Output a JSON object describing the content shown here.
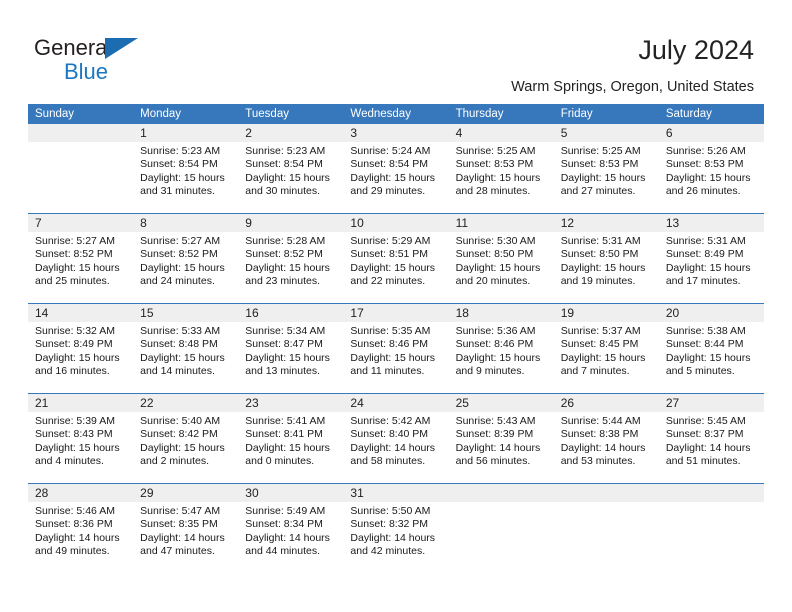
{
  "logo": {
    "line1": "General",
    "line2": "Blue",
    "triangle_color": "#1b6cb0",
    "line2_color": "#1b77c1"
  },
  "header": {
    "title": "July 2024",
    "location": "Warm Springs, Oregon, United States"
  },
  "theme": {
    "header_bar": "#3778bd",
    "daynum_band": "#efefef",
    "text": "#1a1a1a"
  },
  "calendar": {
    "weekday_headers": [
      "Sunday",
      "Monday",
      "Tuesday",
      "Wednesday",
      "Thursday",
      "Friday",
      "Saturday"
    ],
    "weeks": [
      [
        {
          "day": "",
          "sunrise": "",
          "sunset": "",
          "daylight_line1": "",
          "daylight_line2": "",
          "blank": true
        },
        {
          "day": "1",
          "sunrise": "Sunrise: 5:23 AM",
          "sunset": "Sunset: 8:54 PM",
          "daylight_line1": "Daylight: 15 hours",
          "daylight_line2": "and 31 minutes."
        },
        {
          "day": "2",
          "sunrise": "Sunrise: 5:23 AM",
          "sunset": "Sunset: 8:54 PM",
          "daylight_line1": "Daylight: 15 hours",
          "daylight_line2": "and 30 minutes."
        },
        {
          "day": "3",
          "sunrise": "Sunrise: 5:24 AM",
          "sunset": "Sunset: 8:54 PM",
          "daylight_line1": "Daylight: 15 hours",
          "daylight_line2": "and 29 minutes."
        },
        {
          "day": "4",
          "sunrise": "Sunrise: 5:25 AM",
          "sunset": "Sunset: 8:53 PM",
          "daylight_line1": "Daylight: 15 hours",
          "daylight_line2": "and 28 minutes."
        },
        {
          "day": "5",
          "sunrise": "Sunrise: 5:25 AM",
          "sunset": "Sunset: 8:53 PM",
          "daylight_line1": "Daylight: 15 hours",
          "daylight_line2": "and 27 minutes."
        },
        {
          "day": "6",
          "sunrise": "Sunrise: 5:26 AM",
          "sunset": "Sunset: 8:53 PM",
          "daylight_line1": "Daylight: 15 hours",
          "daylight_line2": "and 26 minutes."
        }
      ],
      [
        {
          "day": "7",
          "sunrise": "Sunrise: 5:27 AM",
          "sunset": "Sunset: 8:52 PM",
          "daylight_line1": "Daylight: 15 hours",
          "daylight_line2": "and 25 minutes."
        },
        {
          "day": "8",
          "sunrise": "Sunrise: 5:27 AM",
          "sunset": "Sunset: 8:52 PM",
          "daylight_line1": "Daylight: 15 hours",
          "daylight_line2": "and 24 minutes."
        },
        {
          "day": "9",
          "sunrise": "Sunrise: 5:28 AM",
          "sunset": "Sunset: 8:52 PM",
          "daylight_line1": "Daylight: 15 hours",
          "daylight_line2": "and 23 minutes."
        },
        {
          "day": "10",
          "sunrise": "Sunrise: 5:29 AM",
          "sunset": "Sunset: 8:51 PM",
          "daylight_line1": "Daylight: 15 hours",
          "daylight_line2": "and 22 minutes."
        },
        {
          "day": "11",
          "sunrise": "Sunrise: 5:30 AM",
          "sunset": "Sunset: 8:50 PM",
          "daylight_line1": "Daylight: 15 hours",
          "daylight_line2": "and 20 minutes."
        },
        {
          "day": "12",
          "sunrise": "Sunrise: 5:31 AM",
          "sunset": "Sunset: 8:50 PM",
          "daylight_line1": "Daylight: 15 hours",
          "daylight_line2": "and 19 minutes."
        },
        {
          "day": "13",
          "sunrise": "Sunrise: 5:31 AM",
          "sunset": "Sunset: 8:49 PM",
          "daylight_line1": "Daylight: 15 hours",
          "daylight_line2": "and 17 minutes."
        }
      ],
      [
        {
          "day": "14",
          "sunrise": "Sunrise: 5:32 AM",
          "sunset": "Sunset: 8:49 PM",
          "daylight_line1": "Daylight: 15 hours",
          "daylight_line2": "and 16 minutes."
        },
        {
          "day": "15",
          "sunrise": "Sunrise: 5:33 AM",
          "sunset": "Sunset: 8:48 PM",
          "daylight_line1": "Daylight: 15 hours",
          "daylight_line2": "and 14 minutes."
        },
        {
          "day": "16",
          "sunrise": "Sunrise: 5:34 AM",
          "sunset": "Sunset: 8:47 PM",
          "daylight_line1": "Daylight: 15 hours",
          "daylight_line2": "and 13 minutes."
        },
        {
          "day": "17",
          "sunrise": "Sunrise: 5:35 AM",
          "sunset": "Sunset: 8:46 PM",
          "daylight_line1": "Daylight: 15 hours",
          "daylight_line2": "and 11 minutes."
        },
        {
          "day": "18",
          "sunrise": "Sunrise: 5:36 AM",
          "sunset": "Sunset: 8:46 PM",
          "daylight_line1": "Daylight: 15 hours",
          "daylight_line2": "and 9 minutes."
        },
        {
          "day": "19",
          "sunrise": "Sunrise: 5:37 AM",
          "sunset": "Sunset: 8:45 PM",
          "daylight_line1": "Daylight: 15 hours",
          "daylight_line2": "and 7 minutes."
        },
        {
          "day": "20",
          "sunrise": "Sunrise: 5:38 AM",
          "sunset": "Sunset: 8:44 PM",
          "daylight_line1": "Daylight: 15 hours",
          "daylight_line2": "and 5 minutes."
        }
      ],
      [
        {
          "day": "21",
          "sunrise": "Sunrise: 5:39 AM",
          "sunset": "Sunset: 8:43 PM",
          "daylight_line1": "Daylight: 15 hours",
          "daylight_line2": "and 4 minutes."
        },
        {
          "day": "22",
          "sunrise": "Sunrise: 5:40 AM",
          "sunset": "Sunset: 8:42 PM",
          "daylight_line1": "Daylight: 15 hours",
          "daylight_line2": "and 2 minutes."
        },
        {
          "day": "23",
          "sunrise": "Sunrise: 5:41 AM",
          "sunset": "Sunset: 8:41 PM",
          "daylight_line1": "Daylight: 15 hours",
          "daylight_line2": "and 0 minutes."
        },
        {
          "day": "24",
          "sunrise": "Sunrise: 5:42 AM",
          "sunset": "Sunset: 8:40 PM",
          "daylight_line1": "Daylight: 14 hours",
          "daylight_line2": "and 58 minutes."
        },
        {
          "day": "25",
          "sunrise": "Sunrise: 5:43 AM",
          "sunset": "Sunset: 8:39 PM",
          "daylight_line1": "Daylight: 14 hours",
          "daylight_line2": "and 56 minutes."
        },
        {
          "day": "26",
          "sunrise": "Sunrise: 5:44 AM",
          "sunset": "Sunset: 8:38 PM",
          "daylight_line1": "Daylight: 14 hours",
          "daylight_line2": "and 53 minutes."
        },
        {
          "day": "27",
          "sunrise": "Sunrise: 5:45 AM",
          "sunset": "Sunset: 8:37 PM",
          "daylight_line1": "Daylight: 14 hours",
          "daylight_line2": "and 51 minutes."
        }
      ],
      [
        {
          "day": "28",
          "sunrise": "Sunrise: 5:46 AM",
          "sunset": "Sunset: 8:36 PM",
          "daylight_line1": "Daylight: 14 hours",
          "daylight_line2": "and 49 minutes."
        },
        {
          "day": "29",
          "sunrise": "Sunrise: 5:47 AM",
          "sunset": "Sunset: 8:35 PM",
          "daylight_line1": "Daylight: 14 hours",
          "daylight_line2": "and 47 minutes."
        },
        {
          "day": "30",
          "sunrise": "Sunrise: 5:49 AM",
          "sunset": "Sunset: 8:34 PM",
          "daylight_line1": "Daylight: 14 hours",
          "daylight_line2": "and 44 minutes."
        },
        {
          "day": "31",
          "sunrise": "Sunrise: 5:50 AM",
          "sunset": "Sunset: 8:32 PM",
          "daylight_line1": "Daylight: 14 hours",
          "daylight_line2": "and 42 minutes."
        },
        {
          "day": "",
          "sunrise": "",
          "sunset": "",
          "daylight_line1": "",
          "daylight_line2": "",
          "blank": true
        },
        {
          "day": "",
          "sunrise": "",
          "sunset": "",
          "daylight_line1": "",
          "daylight_line2": "",
          "blank": true
        },
        {
          "day": "",
          "sunrise": "",
          "sunset": "",
          "daylight_line1": "",
          "daylight_line2": "",
          "blank": true
        }
      ]
    ]
  }
}
